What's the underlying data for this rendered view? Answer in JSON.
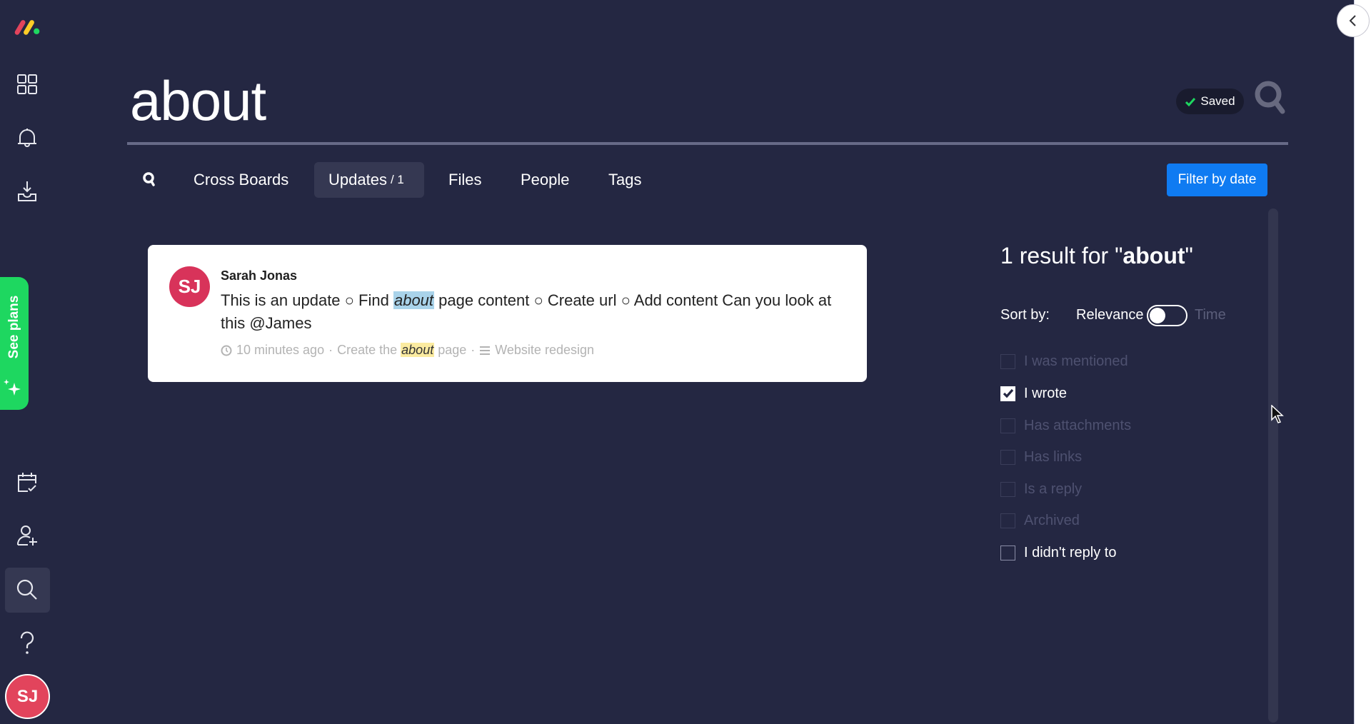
{
  "app": {
    "logo": "monday-logo",
    "brand_colors": {
      "red": "#e2445c",
      "yellow": "#fdcc27",
      "green": "#1ed760"
    }
  },
  "sidebar": {
    "top_items": [
      {
        "icon": "grid-icon",
        "label": "Workspaces"
      },
      {
        "icon": "bell-icon",
        "label": "Notifications"
      },
      {
        "icon": "inbox-download-icon",
        "label": "Inbox"
      }
    ],
    "see_plans_label": "See plans",
    "bottom_items": [
      {
        "icon": "calendar-check-icon",
        "label": "My work"
      },
      {
        "icon": "user-add-icon",
        "label": "Invite members"
      },
      {
        "icon": "search-icon",
        "label": "Search everything",
        "active": true
      },
      {
        "icon": "help-icon",
        "label": "Help"
      }
    ],
    "avatar_initials": "SJ"
  },
  "header": {
    "query": "about",
    "saved_label": "Saved"
  },
  "tabs": [
    {
      "label": "Cross Boards",
      "count": ""
    },
    {
      "label": "Updates",
      "count": "/ 1",
      "active": true
    },
    {
      "label": "Files",
      "count": ""
    },
    {
      "label": "People",
      "count": ""
    },
    {
      "label": "Tags",
      "count": ""
    }
  ],
  "filter_by_date_label": "Filter by date",
  "results": [
    {
      "author": "Sarah Jonas",
      "initials": "SJ",
      "body_before": "This is an update ○ Find ",
      "body_highlight": "about",
      "body_after": " page content ○ Create url ○ Add content Can you look at this @James",
      "time": "10 minutes ago",
      "item_before": "Create the ",
      "item_highlight": "about",
      "item_after": " page",
      "board": "Website redesign"
    }
  ],
  "panel": {
    "results_prefix": "1 result for \"",
    "results_query": "about",
    "results_suffix": "\"",
    "sort_label": "Sort by:",
    "sort_relevance": "Relevance",
    "sort_time": "Time",
    "sort_selected": "Relevance",
    "filters": [
      {
        "label": "I was mentioned",
        "checked": false,
        "enabled": false
      },
      {
        "label": "I wrote",
        "checked": true,
        "enabled": true
      },
      {
        "label": "Has attachments",
        "checked": false,
        "enabled": false
      },
      {
        "label": "Has links",
        "checked": false,
        "enabled": false
      },
      {
        "label": "Is a reply",
        "checked": false,
        "enabled": false
      },
      {
        "label": "Archived",
        "checked": false,
        "enabled": false
      },
      {
        "label": "I didn't reply to",
        "checked": false,
        "enabled": true
      }
    ]
  }
}
